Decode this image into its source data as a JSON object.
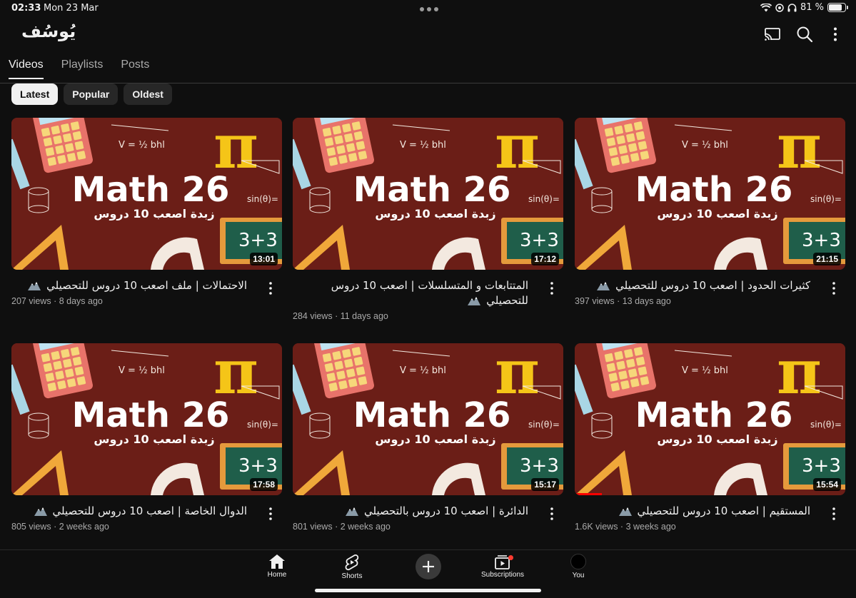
{
  "status_bar": {
    "time": "02:33",
    "date": "Mon 23 Mar",
    "battery": "81 %",
    "battery_level": 0.81
  },
  "channel": {
    "name": "يُوسُف"
  },
  "header_icons": [
    "cast-icon",
    "search-icon",
    "more-vert-icon"
  ],
  "tabs": [
    {
      "label": "Videos",
      "active": true
    },
    {
      "label": "Playlists",
      "active": false
    },
    {
      "label": "Posts",
      "active": false
    }
  ],
  "chips": [
    {
      "label": "Latest",
      "active": true
    },
    {
      "label": "Popular",
      "active": false
    },
    {
      "label": "Oldest",
      "active": false
    }
  ],
  "thumbnail": {
    "headline": "Math 26",
    "subline": "زبدة اصعب 10 دروس",
    "board_text": "3+3",
    "formula": "V = ½ bhl",
    "sin_text": "sin(θ)=",
    "colors": {
      "background": "#6b1e17",
      "text": "#ffffff",
      "pi": "#f5c518",
      "board": "#1f5e4a"
    }
  },
  "videos": [
    {
      "title": "الاحتمالات | ملف اصعب 10 دروس للتحصيلي",
      "views": "207 views",
      "age": "8 days ago",
      "duration": "13:01"
    },
    {
      "title": "المتتابعات و المتسلسلات | اصعب 10 دروس للتحصيلي",
      "views": "284 views",
      "age": "11 days ago",
      "duration": "17:12"
    },
    {
      "title": "كثيرات الحدود | اصعب 10 دروس للتحصيلي",
      "views": "397 views",
      "age": "13 days ago",
      "duration": "21:15"
    },
    {
      "title": "الدوال الخاصة | اصعب 10 دروس للتحصيلي",
      "views": "805 views",
      "age": "2 weeks ago",
      "duration": "17:58"
    },
    {
      "title": "الدائرة | اصعب 10 دروس بالتحصيلي",
      "views": "801 views",
      "age": "2 weeks ago",
      "duration": "15:17"
    },
    {
      "title": "المستقيم | اصعب 10 دروس للتحصيلي",
      "views": "1.6K views",
      "age": "3 weeks ago",
      "duration": "15:54",
      "watched_progress": 0.1
    }
  ],
  "bottom_nav": [
    {
      "label": "Home",
      "icon": "home-icon"
    },
    {
      "label": "Shorts",
      "icon": "shorts-icon"
    },
    {
      "label": "",
      "icon": "create-plus-icon"
    },
    {
      "label": "Subscriptions",
      "icon": "subscriptions-icon"
    },
    {
      "label": "You",
      "icon": "avatar"
    }
  ]
}
